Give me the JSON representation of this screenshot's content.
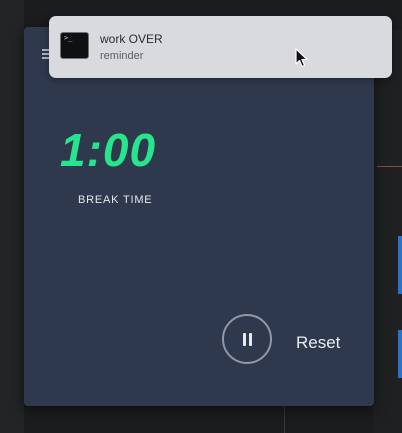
{
  "timer": {
    "time_display": "1:00",
    "mode_label": "BREAK TIME",
    "accent_color": "#27e58c",
    "background_color": "#2f394e",
    "pause_button_icon": "pause-icon",
    "reset_label": "Reset"
  },
  "notification": {
    "app_icon": "terminal-icon",
    "title": "work OVER",
    "body": "reminder"
  }
}
